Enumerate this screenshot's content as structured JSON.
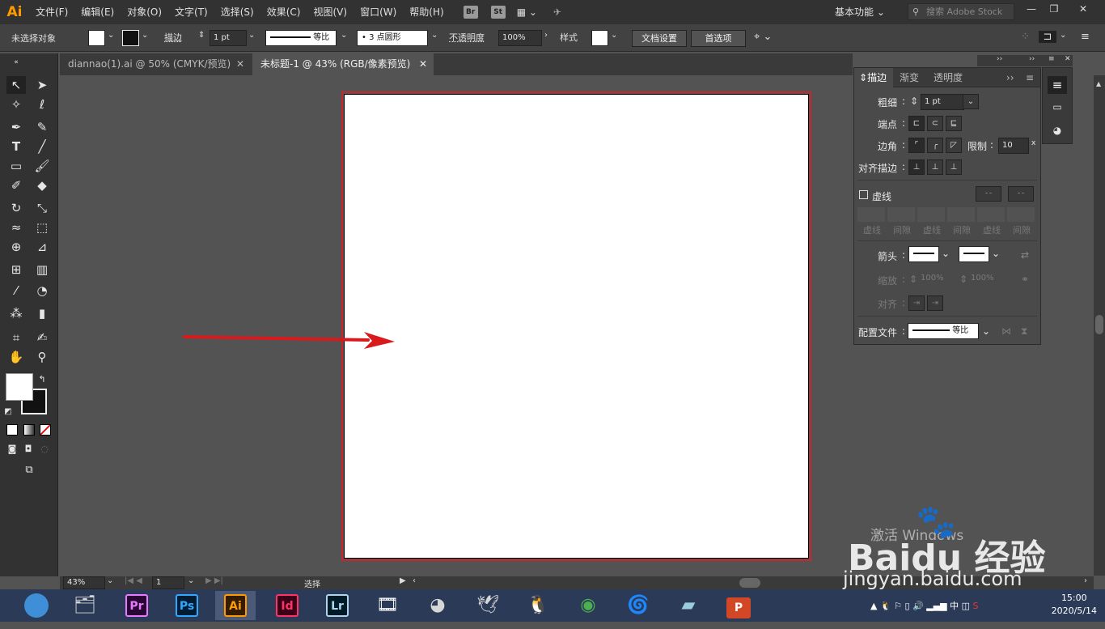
{
  "menubar": {
    "logo": "Ai",
    "items": [
      "文件(F)",
      "编辑(E)",
      "对象(O)",
      "文字(T)",
      "选择(S)",
      "效果(C)",
      "视图(V)",
      "窗口(W)",
      "帮助(H)"
    ],
    "br": "Br",
    "st": "St",
    "workspace": "基本功能",
    "search_placeholder": "搜索 Adobe Stock"
  },
  "control": {
    "selection": "未选择对象",
    "stroke_label": "描边",
    "stroke_weight": "1 pt",
    "profile": "等比",
    "brush": "3 点圆形",
    "opacity_label": "不透明度",
    "opacity": "100%",
    "style_label": "样式",
    "doc_setup": "文档设置",
    "prefs": "首选项"
  },
  "tabs": [
    {
      "label": "diannao(1).ai @ 50% (CMYK/预览)"
    },
    {
      "label": "未标题-1 @ 43% (RGB/像素预览)"
    }
  ],
  "panel": {
    "tabs": [
      "描边",
      "渐变",
      "透明度"
    ],
    "weight_label": "粗细",
    "weight": "1 pt",
    "cap_label": "端点",
    "corner_label": "边角",
    "limit_label": "限制",
    "limit": "10",
    "align_label": "对齐描边",
    "dashed_label": "虚线",
    "dash_labels": [
      "虚线",
      "间隙",
      "虚线",
      "间隙",
      "虚线",
      "间隙"
    ],
    "arrow_label": "箭头",
    "scale_label": "缩放",
    "scale1": "100%",
    "scale2": "100%",
    "align2_label": "对齐",
    "profile_label": "配置文件",
    "profile": "等比"
  },
  "status": {
    "zoom": "43%",
    "page": "1",
    "tool": "选择"
  },
  "taskbar": {
    "apps": [
      "Pr",
      "Ps",
      "Ai",
      "Id",
      "Lr"
    ],
    "time": "15:00",
    "date": "2020/5/14",
    "ime": "中"
  },
  "watermark": {
    "activate": "激活 Windows",
    "brand": "Baidu 经验",
    "url": "jingyan.baidu.com"
  },
  "colors": {
    "accent": "#ff9a00",
    "artboard_border": "#c8262b",
    "arrow": "#d9191c"
  }
}
